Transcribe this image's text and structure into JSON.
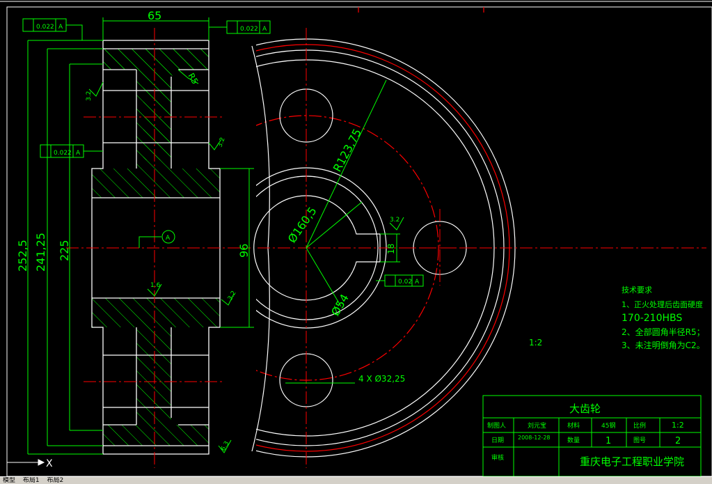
{
  "colors": {
    "bg": "#000000",
    "line": "#ffffff",
    "dim": "#00ff00",
    "center": "#ff0000",
    "hatch": "#00ff00",
    "title": "#00ff00"
  },
  "drawing": {
    "dims": {
      "width_65": "65",
      "d_252": "252,5",
      "d_241": "241,25",
      "d_225": "225",
      "d_96": "96",
      "r123": "R123,75",
      "d160": "Ø160,5",
      "d54": "Ø54",
      "r5": "R5",
      "keyway": "18",
      "holes": "4 X Ø32,25",
      "scale_label": "1:2"
    },
    "roughness": {
      "r1": "3.2",
      "r2": "3.2",
      "r3": "1.6",
      "r4": "3.2",
      "r5": "6.3",
      "r6": "3.2"
    },
    "datum": "A",
    "tol": {
      "runout": "0.022",
      "flat": "0.02",
      "ref": "A"
    }
  },
  "notes": {
    "heading": "技术要求",
    "line1": "1、正火处理后齿面硬度",
    "line2": "170-210HBS",
    "line3": "2、全部圆角半径R5；",
    "line4": "3、未注明倒角为C2。"
  },
  "title_block": {
    "part": "大齿轮",
    "drawer_label": "制图人",
    "drawer": "刘元宝",
    "material_label": "材料",
    "material": "45钢",
    "scale_label": "比例",
    "scale": "1:2",
    "date_label": "日期",
    "date": "2008-12-28",
    "qty_label": "数量",
    "qty": "1",
    "drawno_label": "图号",
    "drawno": "2",
    "check_label": "审核",
    "school": "重庆电子工程职业学院"
  },
  "ucs": "X",
  "tabs": {
    "model": "模型",
    "layout1": "布局1",
    "layout2": "布局2"
  }
}
